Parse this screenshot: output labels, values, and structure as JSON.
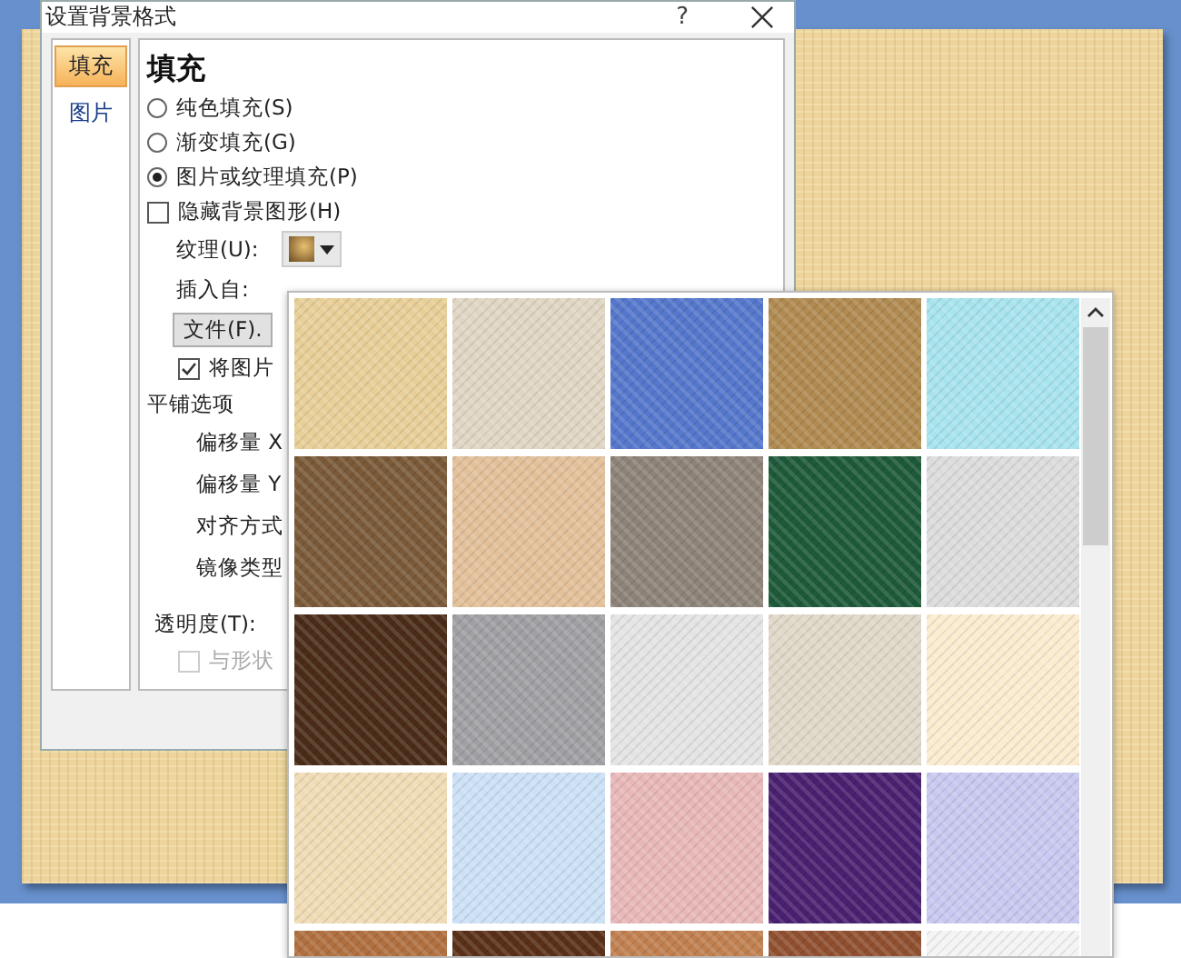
{
  "dialog": {
    "title": "设置背景格式",
    "help": "?",
    "tabs": [
      {
        "label": "填充",
        "selected": true
      },
      {
        "label": "图片",
        "selected": false
      }
    ],
    "heading": "填充",
    "fill_options": [
      {
        "label": "纯色填充(S)",
        "selected": false
      },
      {
        "label": "渐变填充(G)",
        "selected": false
      },
      {
        "label": "图片或纹理填充(P)",
        "selected": true
      }
    ],
    "hide_background": {
      "label": "隐藏背景图形(H)",
      "checked": false
    },
    "texture_label": "纹理(U):",
    "insert_from_label": "插入自:",
    "file_button": "文件(F).",
    "tile_checkbox": {
      "label": "将图片",
      "checked": true
    },
    "tile_options_label": "平铺选项",
    "tile_fields": [
      "偏移量 X",
      "偏移量 Y",
      "对齐方式",
      "镜像类型"
    ],
    "transparency_label": "透明度(T):",
    "rotate_checkbox": {
      "label": "与形状",
      "checked": false,
      "disabled": true
    }
  },
  "texture_gallery": {
    "swatches": [
      {
        "color": "#e8cf98"
      },
      {
        "color": "#e0d6c4"
      },
      {
        "color": "#5577cc"
      },
      {
        "color": "#b08a50"
      },
      {
        "color": "#a8e4ee"
      },
      {
        "color": "#7a5a38"
      },
      {
        "color": "#e2c09a"
      },
      {
        "color": "#8d8378"
      },
      {
        "color": "#1e5a3a"
      },
      {
        "color": "#dcdcdc"
      },
      {
        "color": "#4a2c18"
      },
      {
        "color": "#a0a0a4"
      },
      {
        "color": "#e4e4e4"
      },
      {
        "color": "#e0d8c8"
      },
      {
        "color": "#fbecd0"
      },
      {
        "color": "#f0dcb4"
      },
      {
        "color": "#cce0f6"
      },
      {
        "color": "#e8b8b8"
      },
      {
        "color": "#4a2070"
      },
      {
        "color": "#c8c8f0"
      },
      {
        "color": "#b07040"
      },
      {
        "color": "#5a3018"
      },
      {
        "color": "#c08050"
      },
      {
        "color": "#905030"
      },
      {
        "color": "#f4f4f4"
      }
    ]
  }
}
